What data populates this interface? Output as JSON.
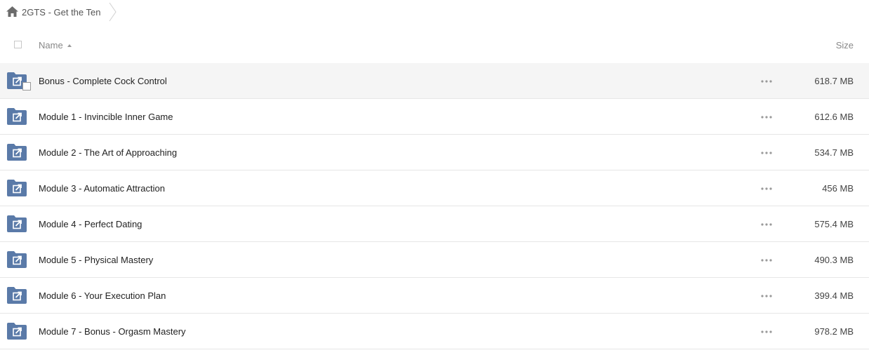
{
  "breadcrumb": {
    "home_icon": "home-icon",
    "current_folder": "2GTS - Get the Ten"
  },
  "header": {
    "name_label": "Name",
    "size_label": "Size",
    "sort_icon": "sort-ascending-icon"
  },
  "colors": {
    "folder_icon": "#5a7aa8",
    "row_hover": "#f5f5f5",
    "divider": "#e6e6e6"
  },
  "rows": [
    {
      "name": "Bonus - Complete Cock Control",
      "size": "618.7 MB"
    },
    {
      "name": "Module 1 - Invincible Inner Game",
      "size": "612.6 MB"
    },
    {
      "name": "Module 2 - The Art of Approaching",
      "size": "534.7 MB"
    },
    {
      "name": "Module 3 - Automatic Attraction",
      "size": "456 MB"
    },
    {
      "name": "Module 4 - Perfect Dating",
      "size": "575.4 MB"
    },
    {
      "name": "Module 5 - Physical Mastery",
      "size": "490.3 MB"
    },
    {
      "name": "Module 6 - Your Execution Plan",
      "size": "399.4 MB"
    },
    {
      "name": "Module 7 - Bonus - Orgasm Mastery",
      "size": "978.2 MB"
    }
  ]
}
